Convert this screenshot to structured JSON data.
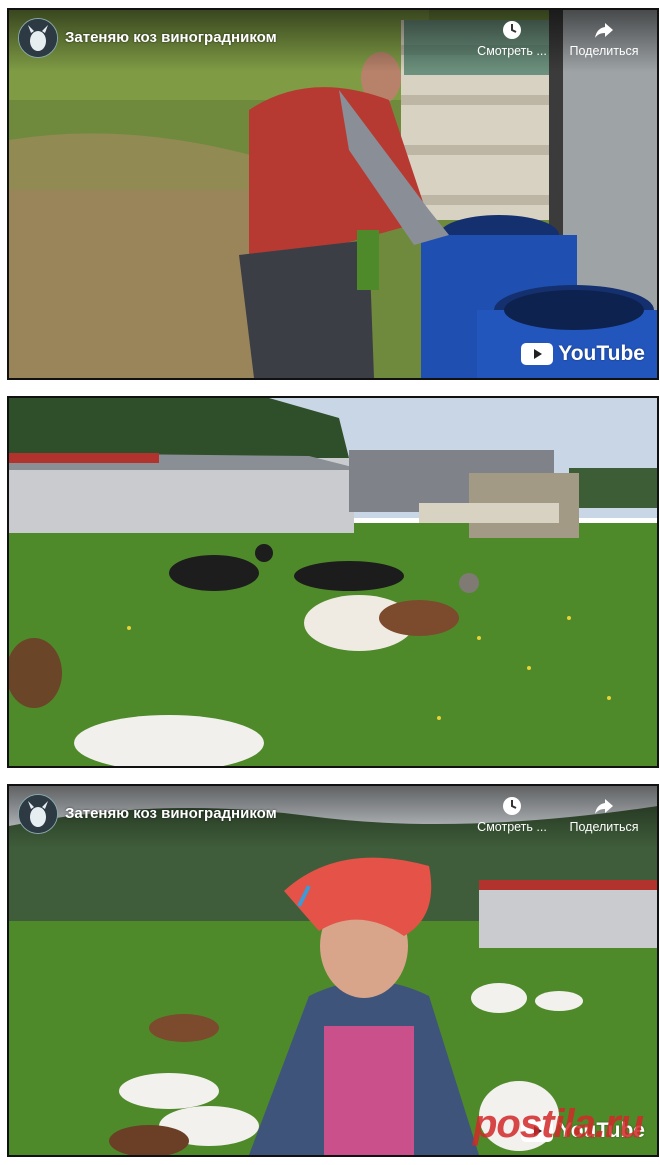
{
  "videos": [
    {
      "channel_avatar": "goat-avatar-icon",
      "title": "Затеняю коз виноградником",
      "actions": {
        "watch_later": "Смотреть ...",
        "share": "Поделиться"
      },
      "logo_text": "YouTube"
    },
    {
      "note": ""
    },
    {
      "channel_avatar": "goat-avatar-icon",
      "title": "Затеняю коз виноградником",
      "actions": {
        "watch_later": "Смотреть ...",
        "share": "Поделиться"
      },
      "logo_text": "YouTube"
    }
  ],
  "watermark": {
    "text": "postila.ru",
    "color": "#d22828"
  },
  "colors": {
    "grass": "#4f8a2a",
    "sky": "#c9d6e6",
    "barrel": "#1f4fb0",
    "shed_roof": "#b2332e"
  }
}
